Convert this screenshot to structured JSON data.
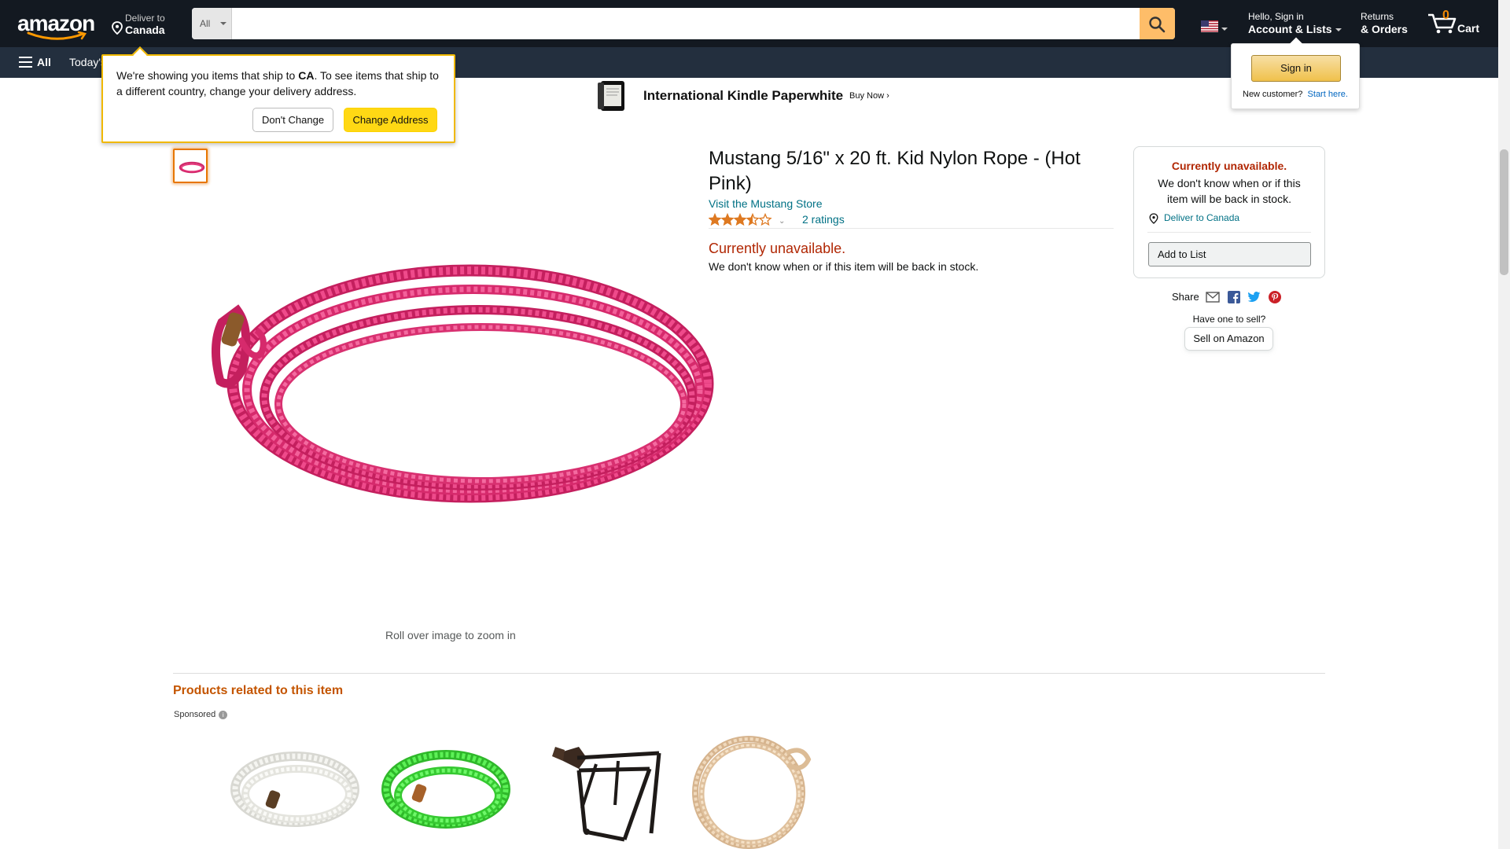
{
  "header": {
    "logo_text": "amazon",
    "deliver_label": "Deliver to",
    "deliver_location": "Canada",
    "search_category": "All",
    "search_value": "",
    "account_greeting": "Hello, Sign in",
    "account_label": "Account & Lists",
    "returns_label": "Returns",
    "orders_label": "& Orders",
    "cart_count": "0",
    "cart_label": "Cart",
    "colors": {
      "nav_bg": "#131921",
      "subnav_bg": "#232f3e",
      "search_button": "#febd69",
      "cart_count": "#f08804"
    }
  },
  "subnav": {
    "menu_label": "All",
    "todays_deals_partial": "Today's"
  },
  "banner": {
    "title": "International Kindle Paperwhite",
    "cta": "Buy Now ›"
  },
  "ship_popover": {
    "message_prefix": "We're showing you items that ship to ",
    "country": "CA",
    "message_suffix": ". To see items that ship to a different country, change your delivery address.",
    "dont_change": "Don't Change",
    "change_address": "Change Address"
  },
  "signin_popover": {
    "button": "Sign in",
    "new_customer": "New customer?",
    "start_here": "Start here."
  },
  "product": {
    "title": "Mustang 5/16\" x 20 ft. Kid Nylon Rope - (Hot Pink)",
    "store_link": "Visit the Mustang Store",
    "rating": 3.5,
    "ratings_count": "2 ratings",
    "availability": "Currently unavailable.",
    "availability_note": "We don't know when or if this item will be back in stock.",
    "zoom_hint": "Roll over image to zoom in",
    "rope_color": "#e8347a"
  },
  "buybox": {
    "availability": "Currently unavailable.",
    "availability_note": "We don't know when or if this item will be back in stock.",
    "deliver_to": "Deliver to Canada",
    "add_to_list": "Add to List",
    "share_label": "Share",
    "have_one": "Have one to sell?",
    "sell_button": "Sell on Amazon"
  },
  "related": {
    "title": "Products related to this item",
    "sponsored": "Sponsored",
    "items": [
      {
        "name": "white-rope",
        "color": "#f2f2ee"
      },
      {
        "name": "green-rope",
        "color": "#3fd93a"
      },
      {
        "name": "saddle-rack",
        "color": "#2a211c"
      },
      {
        "name": "tan-rope",
        "color": "#e8cba8"
      }
    ]
  }
}
